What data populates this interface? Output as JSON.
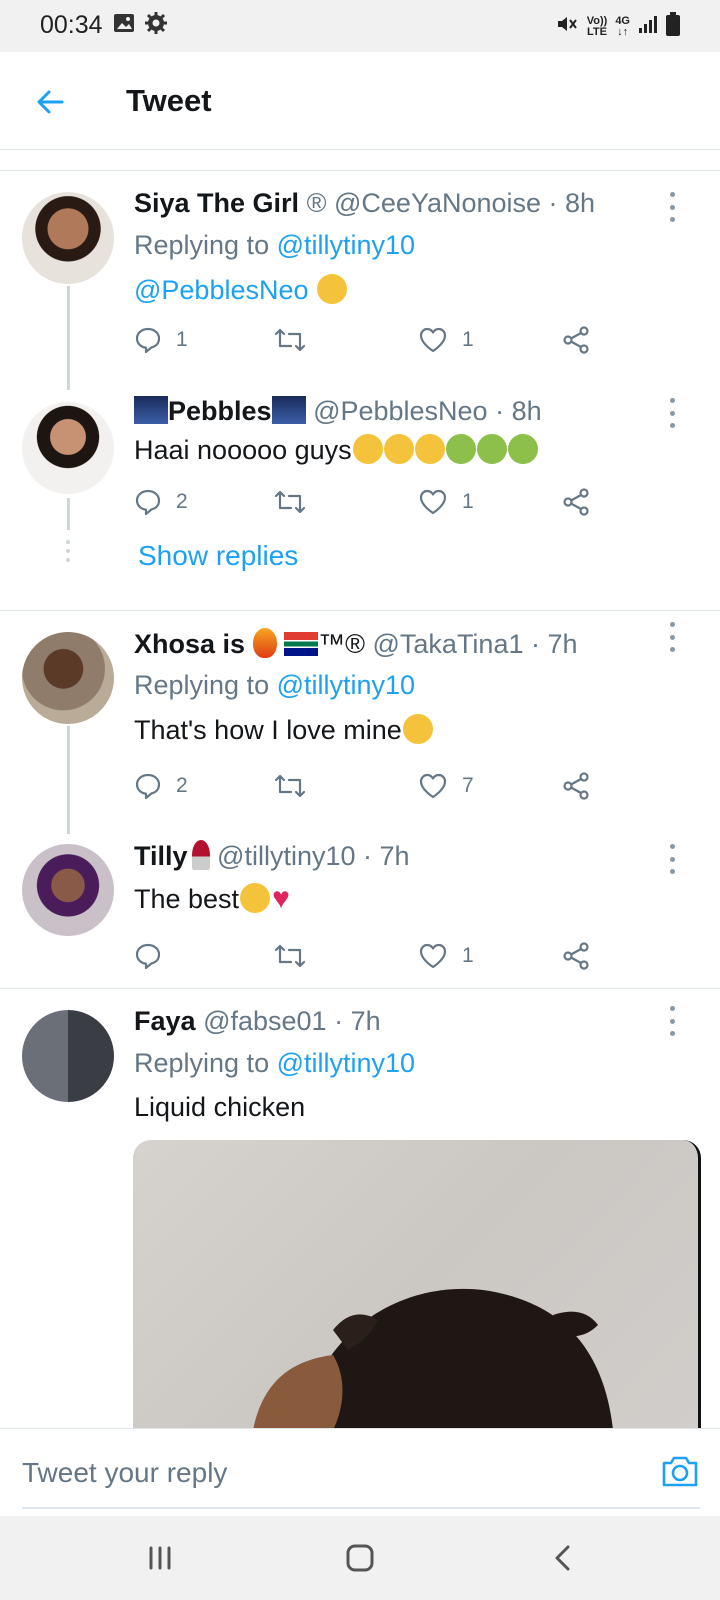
{
  "status_bar": {
    "time": "00:34",
    "volte_top": "Vo))",
    "volte_bottom": "LTE",
    "network": "4G"
  },
  "header": {
    "title": "Tweet"
  },
  "colors": {
    "accent": "#1da1f2",
    "text": "#14171a",
    "secondary": "#657786",
    "heart_red": "#e0245e"
  },
  "tweets": [
    {
      "name": "Siya The Girl",
      "name_suffix": "®",
      "handle": "@CeeYaNonoise",
      "time": "· 8h",
      "replying_label": "Replying to",
      "replying_to": "@tillytiny10",
      "text": "@PebblesNeo",
      "replies": "1",
      "likes": "1"
    },
    {
      "name": "Pebbles",
      "handle": "@PebblesNeo",
      "time": "· 8h",
      "text": "Haai nooooo guys",
      "replies": "2",
      "likes": "1",
      "show_replies": "Show replies"
    },
    {
      "name": "Xhosa is",
      "name_suffix": "™®",
      "handle": "@TakaTina1",
      "time": "· 7h",
      "replying_label": "Replying to",
      "replying_to": "@tillytiny10",
      "text": "That's how I love mine",
      "replies": "2",
      "likes": "7"
    },
    {
      "name": "Tilly",
      "handle": "@tillytiny10",
      "time": "· 7h",
      "text": "The best",
      "replies": "",
      "likes": "1"
    },
    {
      "name": "Faya",
      "handle": "@fabse01",
      "time": "· 7h",
      "replying_label": "Replying to",
      "replying_to": "@tillytiny10",
      "text": "Liquid chicken"
    }
  ],
  "reply_bar": {
    "placeholder": "Tweet your reply"
  }
}
